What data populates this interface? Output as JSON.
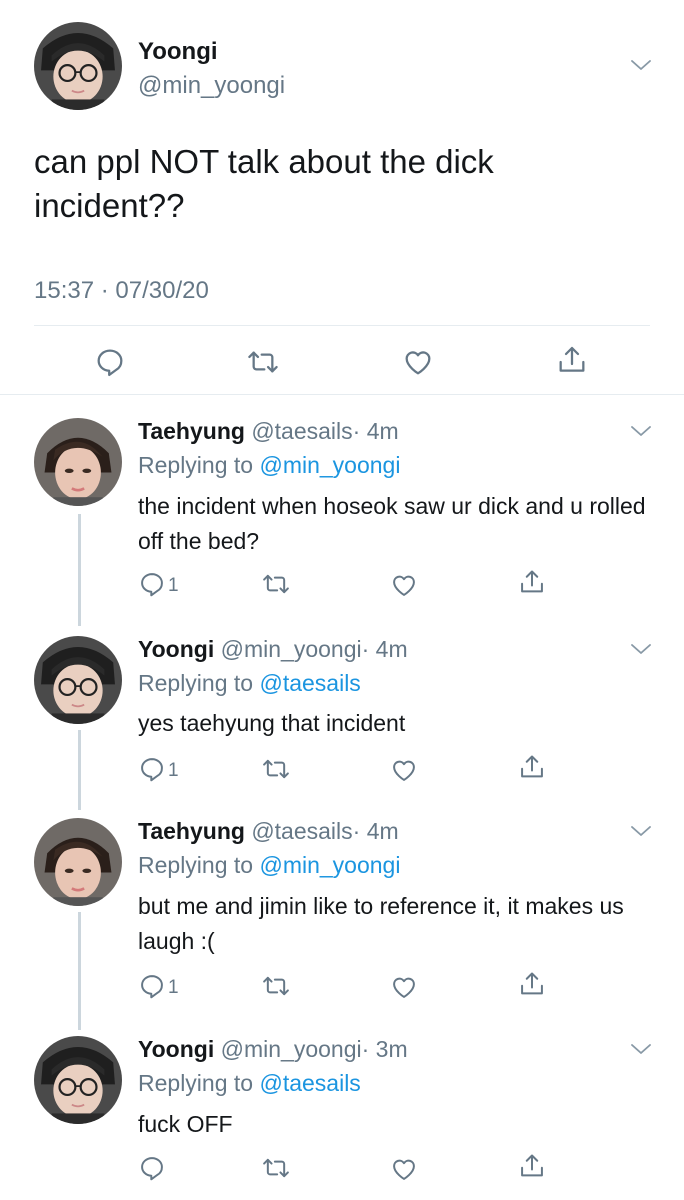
{
  "main_tweet": {
    "display_name": "Yoongi",
    "handle": "@min_yoongi",
    "text": "can ppl NOT talk about the dick incident??",
    "timestamp": "15:37 · 07/30/20"
  },
  "replies": [
    {
      "display_name": "Taehyung",
      "handle": "@taesails",
      "time": "· 4m",
      "replying_prefix": "Replying to",
      "replying_to": "@min_yoongi",
      "text": "the incident when hoseok saw ur dick and u rolled off the bed?",
      "reply_count": "1"
    },
    {
      "display_name": "Yoongi",
      "handle": "@min_yoongi",
      "time": "· 4m",
      "replying_prefix": "Replying to",
      "replying_to": "@taesails",
      "text": "yes taehyung that incident",
      "reply_count": "1"
    },
    {
      "display_name": "Taehyung",
      "handle": "@taesails",
      "time": "· 4m",
      "replying_prefix": "Replying to",
      "replying_to": "@min_yoongi",
      "text": "but me and jimin like to reference it, it makes us laugh :(",
      "reply_count": "1"
    },
    {
      "display_name": "Yoongi",
      "handle": "@min_yoongi",
      "time": "· 3m",
      "replying_prefix": "Replying to",
      "replying_to": "@taesails",
      "text": "fuck OFF",
      "reply_count": ""
    }
  ],
  "icons": [
    "reply-icon",
    "retweet-icon",
    "like-icon",
    "share-icon",
    "chevron-down-icon"
  ],
  "colors": {
    "link": "#1b95e0",
    "muted": "#657786",
    "divider": "#e6ecf0",
    "thread": "#ccd6dd"
  }
}
